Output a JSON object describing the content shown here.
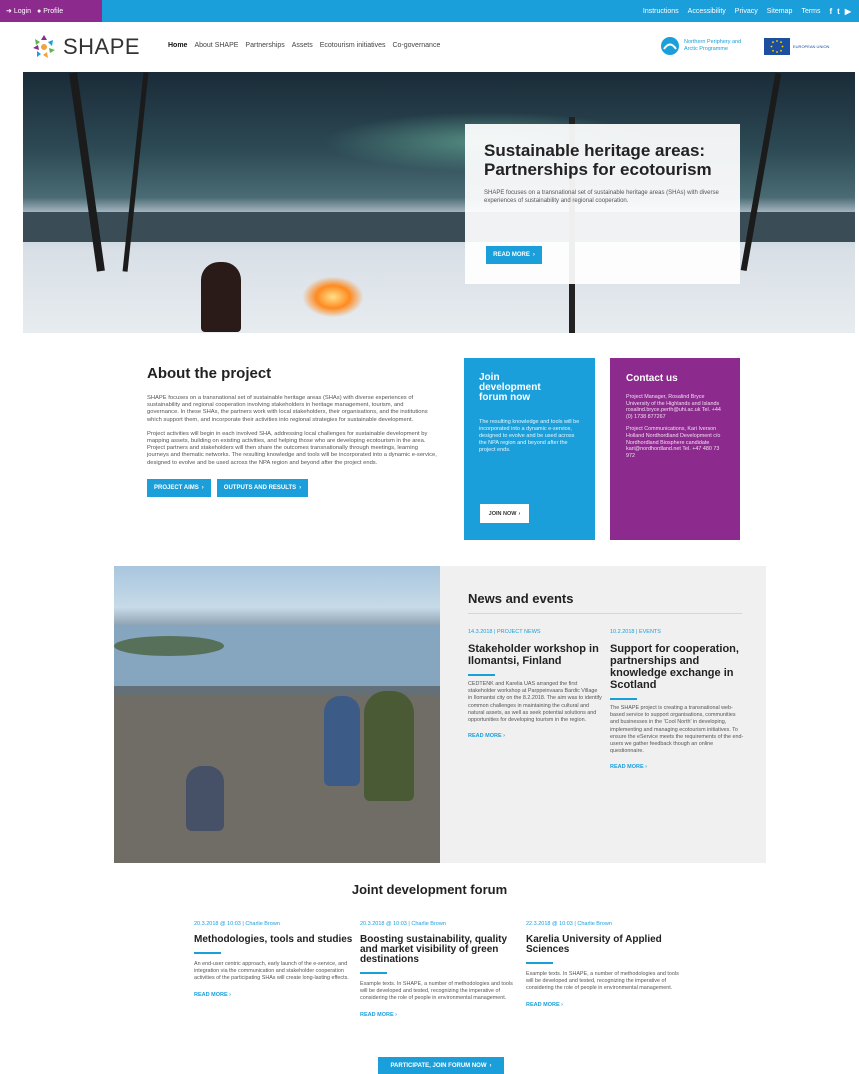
{
  "topbar": {
    "login": "Login",
    "profile": "Profile",
    "links": [
      "Instructions",
      "Accessibility",
      "Privacy",
      "Sitemap",
      "Terms"
    ],
    "social": [
      "f",
      "t",
      "▶"
    ]
  },
  "header": {
    "logo_text": "SHAPE",
    "nav": [
      "Home",
      "About SHAPE",
      "Partnerships",
      "Assets",
      "Ecotourism initiatives",
      "Co-governance"
    ],
    "npa_text": "Northern Periphery and Arctic Programme",
    "eu_text": "EUROPEAN UNION"
  },
  "hero": {
    "title": "Sustainable heritage areas: Partnerships for ecotourism",
    "text": "SHAPE focuses on a transnational set of sustainable heritage areas (SHAs) with diverse experiences of sustainability and regional cooperation.",
    "button": "READ MORE"
  },
  "about": {
    "title": "About the project",
    "p1": "SHAPE focuses on a transnational set of sustainable heritage areas (SHAs) with diverse experiences of sustainability and regional cooperation involving stakeholders in heritage management, tourism, and governance. In these SHAs, the partners work with local stakeholders, their organisations, and the institutions which support them, and incorporate their activities into regional strategies for sustainable development.",
    "p2": "Project activities will begin in each involved SHA, addressing local challenges for sustainable development by mapping assets, building on existing activities, and helping those who are developing ecotourism in the area. Project partners and stakeholders will then share the outcomes transnationally through meetings, learning journeys and thematic networks. The resulting knowledge and tools will be incorporated into a dynamic e-service, designed to evolve and be used across the NPA region and beyond after the project ends.",
    "btn1": "PROJECT AIMS",
    "btn2": "OUTPUTS AND RESULTS"
  },
  "join": {
    "title": "Join development forum now",
    "text": "The resulting knowledge and tools will be incorporated into a dynamic e-service, designed to evolve and be used across the NPA region and beyond after the project ends.",
    "button": "JOIN NOW"
  },
  "contact": {
    "title": "Contact us",
    "p1": "Project Manager, Rosalind Bryce University of the Highlands and Islands rosalind.bryce.perth@uhi.ac.uk Tel. +44 (0) 1738 877267",
    "p2": "Project Communications, Kari Iverson Holland Nordhordland Development c/o Nordhordland Biosphere candidate kari@nordhordland.net Tel. +47 480 73 972"
  },
  "news": {
    "title": "News and events",
    "items": [
      {
        "meta": "14.3.2018 | PROJECT NEWS",
        "title": "Stakeholder workshop in Ilomantsi, Finland",
        "text": "CEDTENK and Karelia UAS arranged the first stakeholder workshop at Parppeinvaara Bardic Village in Ilomantsi city on the 8.2.2018. The aim was to identify common challenges in maintaining the cultural and natural assets, as well as seek potential solutions and opportunities for developing tourism in the region.",
        "readmore": "READ MORE"
      },
      {
        "meta": "10.2.2018 | EVENTS",
        "title": "Support for cooperation, partnerships and knowledge exchange in Scotland",
        "text": "The SHAPE project is creating a transnational web-based service to support organisations, communities and businesses in the 'Cool North' in developing, implementing and managing ecotourism initiatives. To ensure the eService meets the requirements of the end-users we gather feedback though an online questionnaire.",
        "readmore": "READ MORE"
      }
    ]
  },
  "forum": {
    "title": "Joint development forum",
    "items": [
      {
        "meta": "20.3.2018 @ 10:03 | Charlie Brown",
        "title": "Methodologies, tools and studies",
        "text": "An end-user centric approach, early launch of the e-service, and integration via the communication and stakeholder cooperation activities of the participating SHAs will create long-lasting effects.",
        "readmore": "READ MORE"
      },
      {
        "meta": "20.3.2018 @ 10:03 | Charlie Brown",
        "title": "Boosting sustainability, quality and market visibility of green destinations",
        "text": "Example texts. In SHAPE, a number of methodologies and tools will be developed and tested, recognizing the imperative of considering the role of people in environmental management.",
        "readmore": "READ MORE"
      },
      {
        "meta": "22.3.2018 @ 10:03 | Charlie Brown",
        "title": "Karelia University of Applied Sciences",
        "text": "Example texts. In SHAPE, a number of methodologies and tools will be developed and tested, recognizing the imperative of considering the role of people in environmental management.",
        "readmore": "READ MORE"
      }
    ],
    "button": "PARTICIPATE, JOIN FORUM NOW"
  },
  "colors": {
    "blue": "#1a9fdb",
    "purple": "#8c2a8e"
  }
}
